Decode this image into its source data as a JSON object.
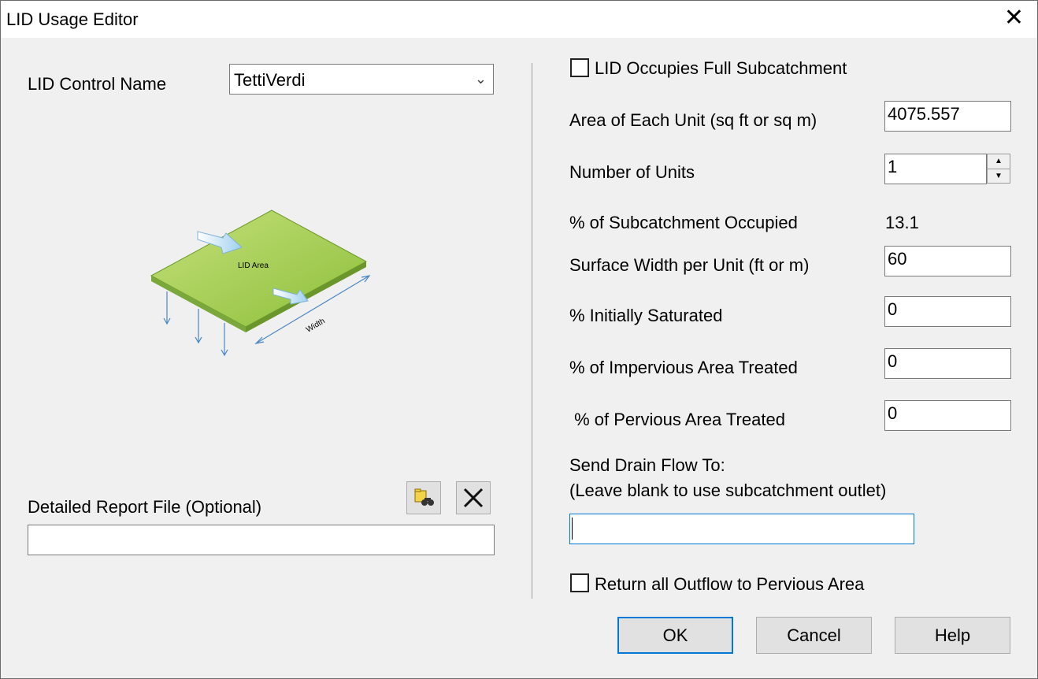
{
  "window": {
    "title": "LID Usage Editor"
  },
  "left": {
    "lid_control_label": "LID Control Name",
    "lid_control_value": "TettiVerdi",
    "diagram": {
      "area_label": "LID Area",
      "width_label": "Width"
    },
    "report_label": "Detailed Report File (Optional)",
    "report_value": ""
  },
  "right": {
    "full_subcatchment_label": "LID Occupies Full Subcatchment",
    "area_label": "Area of Each Unit (sq ft or sq m)",
    "area_value": "4075.557",
    "units_label": "Number of Units",
    "units_value": "1",
    "occupied_label": "% of Subcatchment Occupied",
    "occupied_value": "13.1",
    "width_label": "Surface Width per Unit (ft or m)",
    "width_value": "60",
    "saturated_label": "% Initially Saturated",
    "saturated_value": "0",
    "impervious_label": "% of Impervious Area Treated",
    "impervious_value": "0",
    "pervious_label": " % of Pervious Area Treated",
    "pervious_value": "0",
    "drain_label_1": "Send Drain Flow To:",
    "drain_label_2": "(Leave blank to use subcatchment outlet)",
    "drain_value": "",
    "return_label": "Return all Outflow to Pervious Area"
  },
  "buttons": {
    "ok": "OK",
    "cancel": "Cancel",
    "help": "Help"
  },
  "icons": {
    "browse": "browse-folder-icon",
    "clear": "clear-x-icon",
    "close": "close-icon",
    "spin_up": "spin-up-icon",
    "spin_down": "spin-down-icon",
    "dropdown": "chevron-down-icon"
  }
}
